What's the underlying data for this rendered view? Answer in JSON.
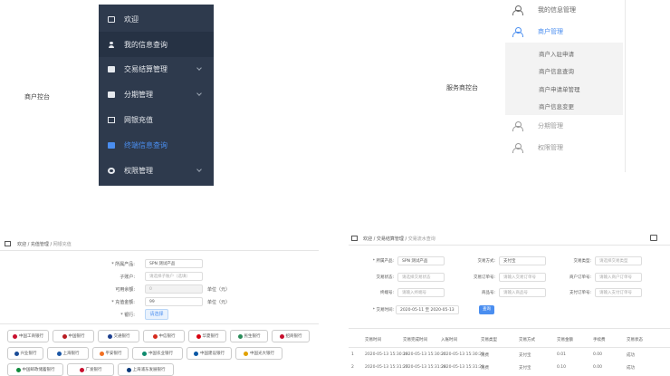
{
  "captions": {
    "merchant": "商户控台",
    "service": "服务商控台"
  },
  "merchant_menu": {
    "items": [
      {
        "label": "欢迎",
        "icon": "monitor-icon"
      },
      {
        "label": "我的信息查询",
        "icon": "user-icon"
      },
      {
        "label": "交易结算管理",
        "icon": "ledger-icon"
      },
      {
        "label": "分期管理",
        "icon": "installment-icon"
      },
      {
        "label": "网银充值",
        "icon": "card-icon"
      },
      {
        "label": "终端信息查询",
        "icon": "camera-icon"
      },
      {
        "label": "权限管理",
        "icon": "gear-icon"
      }
    ],
    "active_label": "终端信息查询",
    "active_color": "#4a8ef0",
    "background": "#2e3a4d"
  },
  "service_menu": {
    "items": [
      {
        "label": "我的信息管理"
      },
      {
        "label": "商户管理"
      },
      {
        "label": "分期管理"
      },
      {
        "label": "权限管理"
      }
    ],
    "sub_items": [
      "商户入驻申请",
      "商户信息查询",
      "商户申请单管理",
      "商户信息变更"
    ]
  },
  "recharge": {
    "breadcrumb": [
      "欢迎",
      "充值管理",
      "网银充值"
    ],
    "labels": {
      "product": "* 所属产品:",
      "account": "子账户:",
      "available": "可用余额:",
      "amount": "* 充值金额:",
      "bank": "* 银行:"
    },
    "product_value": "SPN 测试产品",
    "account_placeholder": "请选择子账户（选填）",
    "available_value": "0",
    "amount_value": "99",
    "unit": "单位（元）",
    "select_bank_button": "请选择",
    "banks": [
      {
        "name": "中国工商银行",
        "color": "#c8102e"
      },
      {
        "name": "中国银行",
        "color": "#b81c22"
      },
      {
        "name": "交通银行",
        "color": "#1d3f8f"
      },
      {
        "name": "中信银行",
        "color": "#d52b1e"
      },
      {
        "name": "华夏银行",
        "color": "#d7000f"
      },
      {
        "name": "民生银行",
        "color": "#2a8c5a"
      },
      {
        "name": "招商银行",
        "color": "#c8102e"
      },
      {
        "name": "兴业银行",
        "color": "#1a4c97"
      },
      {
        "name": "上海银行",
        "color": "#1b56a5"
      },
      {
        "name": "平安银行",
        "color": "#f26f21"
      },
      {
        "name": "中国农业银行",
        "color": "#0e8a6d"
      },
      {
        "name": "中国建设银行",
        "color": "#0a57a4"
      },
      {
        "name": "中国光大银行",
        "color": "#e1a100"
      },
      {
        "name": "中国邮政储蓄银行",
        "color": "#0f8a3c"
      },
      {
        "name": "广发银行",
        "color": "#c8102e"
      },
      {
        "name": "上海浦东发展银行",
        "color": "#0b3a7a"
      }
    ]
  },
  "query": {
    "breadcrumb": [
      "欢迎",
      "交易结算管理",
      "交易流水查询"
    ],
    "filters": [
      {
        "label": "* 所属产品:",
        "value": "SPN 测试产品"
      },
      {
        "label": "交易方式:",
        "value": "支付宝"
      },
      {
        "label": "交易类型:",
        "value": "请选择交易类型"
      },
      {
        "label": "交易状态:",
        "value": "请选择交易状态"
      },
      {
        "label": "交易订单号:",
        "value": "请输入交易订单号"
      },
      {
        "label": "商户订单号:",
        "value": "请输入商户订单号"
      },
      {
        "label": "终端号:",
        "value": "请输入终端号"
      },
      {
        "label": "商品号:",
        "value": "请输入商品号"
      },
      {
        "label": "支付订单号:",
        "value": "请输入支付订单号"
      }
    ],
    "date_label": "* 交易时间:",
    "date_value": "2020-05-11  至  2020-05-13",
    "search_button": "查询",
    "columns": [
      "交易时间",
      "交易完成时间",
      "入账时间",
      "交易类型",
      "交易方式",
      "交易金额",
      "手续费",
      "交易状态"
    ],
    "rows": [
      {
        "no": "1",
        "cells": [
          "2020-05-13 15:30:19",
          "2020-05-13 15:30:20",
          "2020-05-13 15:30:20",
          "消费",
          "支付宝",
          "0.01",
          "0.00",
          "成功"
        ]
      },
      {
        "no": "2",
        "cells": [
          "2020-05-13 15:31:27",
          "2020-05-13 15:31:28",
          "2020-05-13 15:31:28",
          "消费",
          "支付宝",
          "0.10",
          "0.00",
          "成功"
        ]
      }
    ]
  }
}
